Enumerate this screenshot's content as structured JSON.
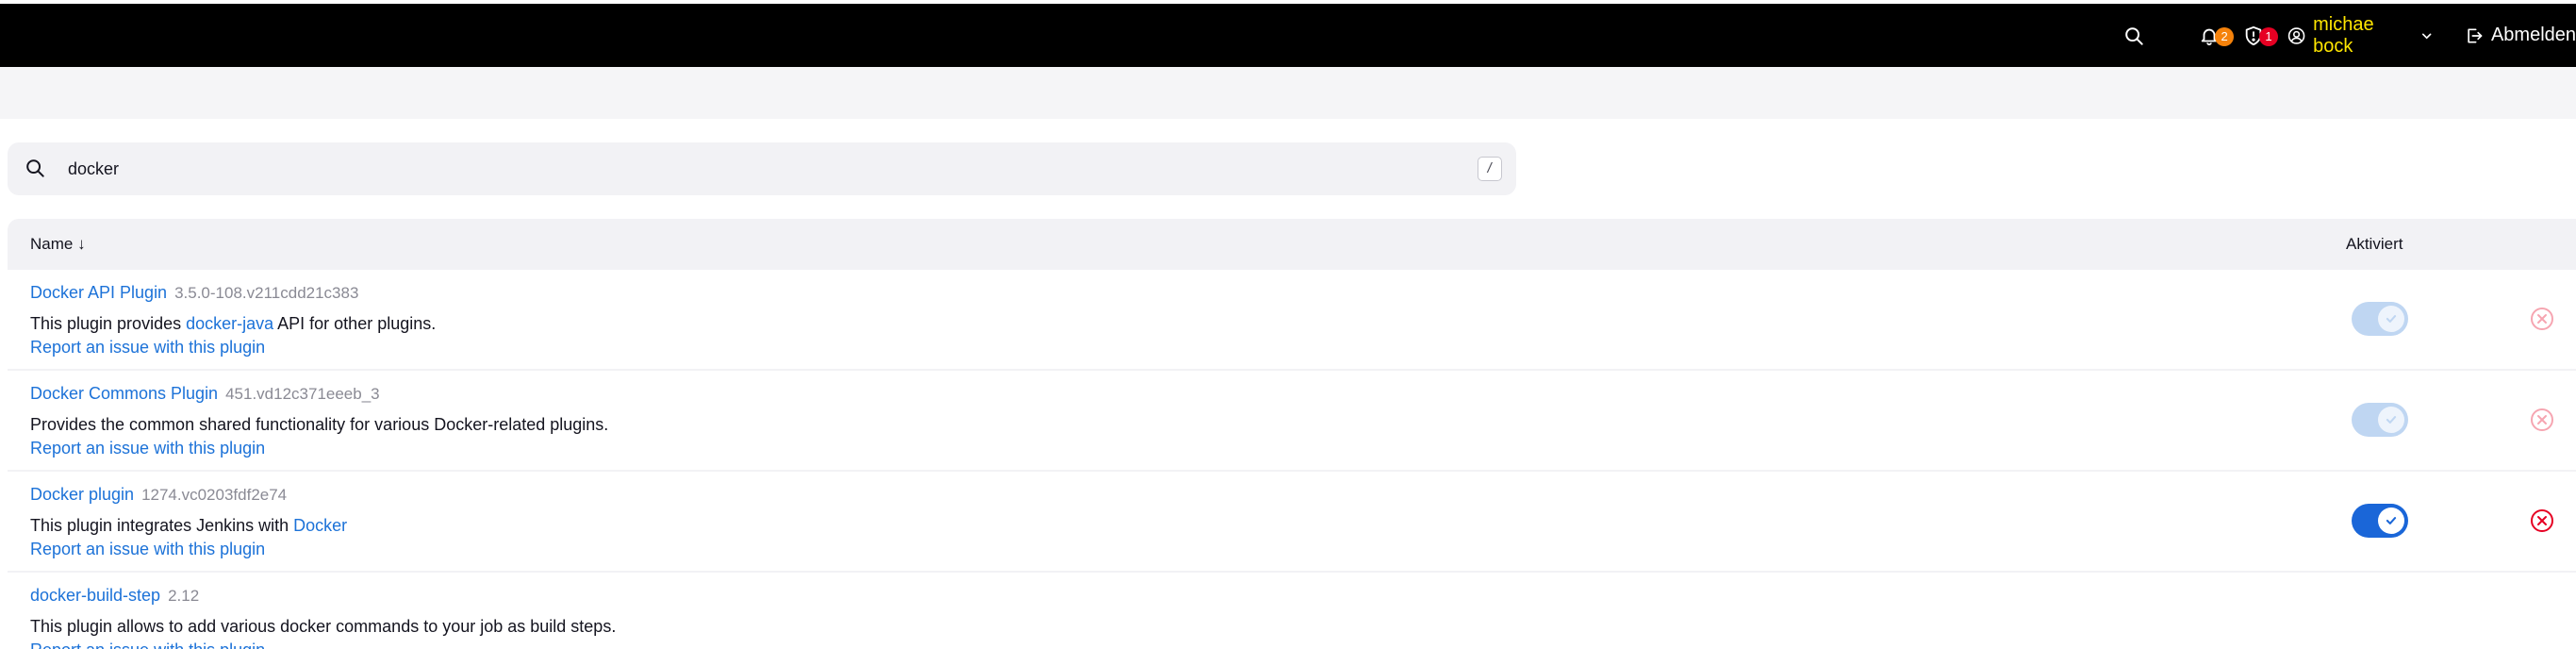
{
  "header": {
    "notifications_count": "2",
    "security_count": "1",
    "user_name": "michae bock",
    "logout_label": "Abmelden"
  },
  "search": {
    "value": "docker",
    "shortcut": "/"
  },
  "table": {
    "col_name": "Name ↓",
    "col_active": "Aktiviert",
    "rows": [
      {
        "name": "Docker API Plugin",
        "version": "3.5.0-108.v211cdd21c383",
        "desc_pre": "This plugin provides ",
        "desc_link": "docker-java",
        "desc_post": " API for other plugins.",
        "report": "Report an issue with this plugin",
        "enabled": true,
        "toggle_disabled": true,
        "uninstall_disabled": true
      },
      {
        "name": "Docker Commons Plugin",
        "version": "451.vd12c371eeeb_3",
        "desc_pre": "Provides the common shared functionality for various Docker-related plugins.",
        "desc_link": "",
        "desc_post": "",
        "report": "Report an issue with this plugin",
        "enabled": true,
        "toggle_disabled": true,
        "uninstall_disabled": true
      },
      {
        "name": "Docker plugin",
        "version": "1274.vc0203fdf2e74",
        "desc_pre": "This plugin integrates Jenkins with ",
        "desc_link": "Docker",
        "desc_post": "",
        "report": "Report an issue with this plugin",
        "enabled": true,
        "toggle_disabled": false,
        "uninstall_disabled": false
      },
      {
        "name": "docker-build-step",
        "version": "2.12",
        "desc_pre": "This plugin allows to add various docker commands to your job as build steps.",
        "desc_link": "",
        "desc_post": "",
        "report": "Report an issue with this plugin",
        "enabled": true,
        "toggle_disabled": false,
        "uninstall_disabled": false
      }
    ]
  },
  "colors": {
    "header_bg": "#000000",
    "user_name": "#ffe600",
    "link": "#1c72d8",
    "toggle_on": "#1a66d8",
    "uninstall": "#e60023",
    "badge_notifications": "#f5820b",
    "badge_security": "#e60023"
  }
}
